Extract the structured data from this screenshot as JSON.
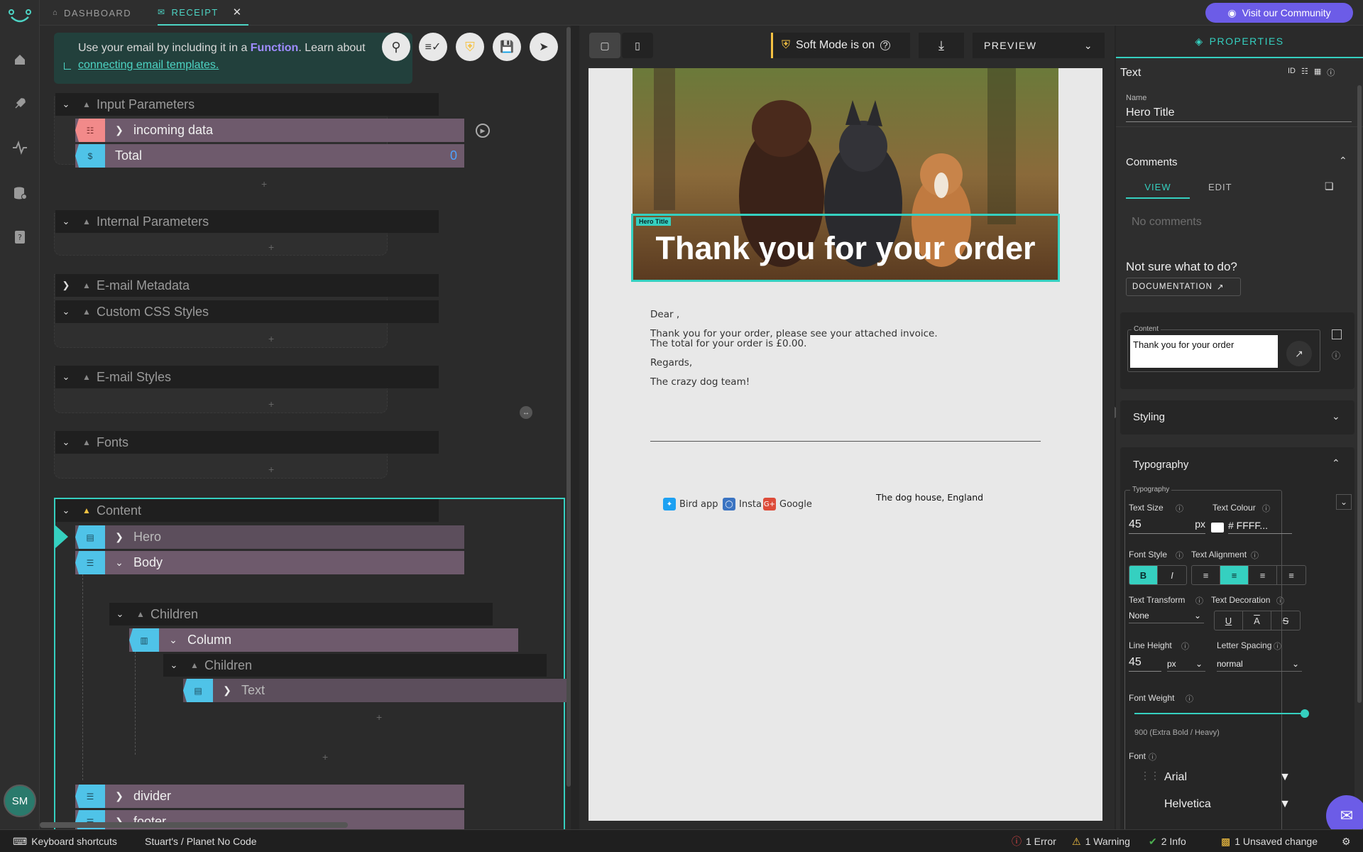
{
  "nav": {
    "avatar_initials": "SM",
    "items": [
      "home-icon",
      "rocket-icon",
      "activity-icon",
      "database-icon",
      "help-book-icon"
    ]
  },
  "tabs": [
    {
      "label": "DASHBOARD",
      "icon": "house-icon"
    },
    {
      "label": "RECEIPT",
      "icon": "mail-icon",
      "active": true
    }
  ],
  "community_button": "Visit our Community",
  "hint": {
    "text_before": "Use your email by including it in a ",
    "highlight": "Function",
    "text_after": ". Learn about",
    "link": "connecting email templates."
  },
  "tree": {
    "input_parameters": "Input Parameters",
    "incoming_data": "incoming data",
    "total_label": "Total",
    "total_value": "0",
    "internal_parameters": "Internal Parameters",
    "email_metadata": "E-mail Metadata",
    "custom_css": "Custom CSS Styles",
    "email_styles": "E-mail Styles",
    "fonts": "Fonts",
    "content": "Content",
    "hero": "Hero",
    "body": "Body",
    "children": "Children",
    "column": "Column",
    "children2": "Children",
    "text": "Text",
    "divider": "divider",
    "footer": "footer",
    "plus": "+"
  },
  "preview": {
    "soft_mode": "Soft Mode is on",
    "mode": "PREVIEW",
    "hero_label": "Hero Title",
    "hero_title": "Thank you for your order",
    "greeting": "Dear ,",
    "line1": "Thank you for your order, please see your attached invoice.",
    "line2": "The total for your order is £0.00.",
    "regards": "Regards,",
    "signoff": "The crazy dog team!",
    "social": [
      {
        "label": "Bird app",
        "color": "#1da1f2",
        "icon": "twitter-icon"
      },
      {
        "label": "Insta",
        "color": "#3b74c2",
        "icon": "instagram-icon"
      },
      {
        "label": "Google",
        "color": "#dd4b39",
        "icon": "google-plus-icon"
      }
    ],
    "address": "The dog house, England"
  },
  "properties": {
    "header": "PROPERTIES",
    "component": "Text",
    "name_label": "Name",
    "name_value": "Hero Title",
    "comments": "Comments",
    "view": "VIEW",
    "edit": "EDIT",
    "no_comments": "No comments",
    "not_sure": "Not sure what to do?",
    "documentation": "DOCUMENTATION",
    "content_label": "Content",
    "content_value": "Thank you for your order",
    "styling": "Styling",
    "typography": "Typography",
    "typography_sub": "Typography",
    "text_size_label": "Text Size",
    "text_size_value": "45",
    "text_size_unit": "px",
    "text_colour_label": "Text Colour",
    "text_colour_value": "# FFFF...",
    "font_style_label": "Font Style",
    "text_alignment_label": "Text Alignment",
    "text_transform_label": "Text Transform",
    "text_transform_value": "None",
    "text_decoration_label": "Text Decoration",
    "line_height_label": "Line Height",
    "line_height_value": "45",
    "line_height_unit": "px",
    "letter_spacing_label": "Letter Spacing",
    "letter_spacing_value": "normal",
    "font_weight_label": "Font Weight",
    "font_weight_value": "900 (Extra Bold / Heavy)",
    "font_weight_level": 1.0,
    "font_label": "Font",
    "font_1": "Arial",
    "font_2": "Helvetica"
  },
  "status": {
    "shortcuts": "Keyboard shortcuts",
    "project": "Stuart's / Planet No Code",
    "error": "1 Error",
    "warning": "1 Warning",
    "info": "2 Info",
    "unsaved": "1 Unsaved change"
  },
  "colors": {
    "accent": "#35d0c0",
    "brand": "#6c5ce7",
    "error": "#e54848",
    "warning": "#f5c242",
    "info": "#4caf50"
  }
}
